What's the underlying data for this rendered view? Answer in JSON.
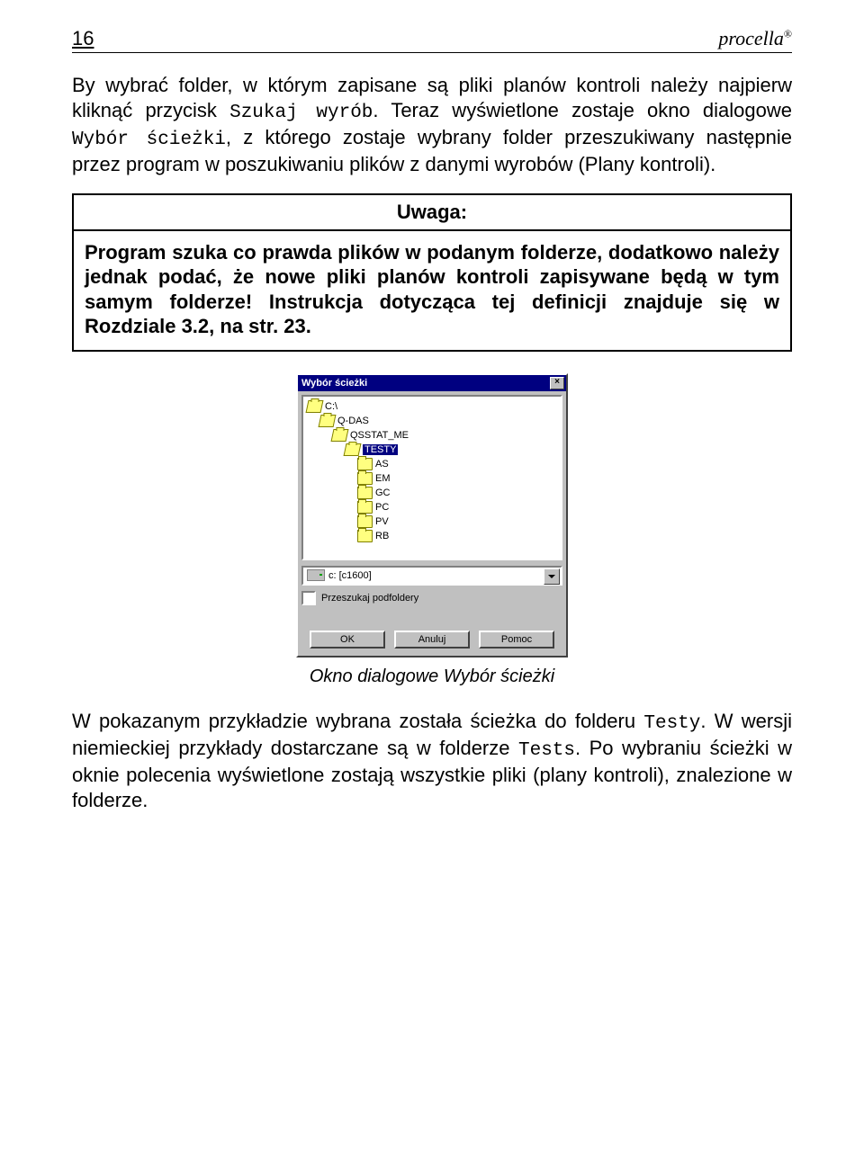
{
  "header": {
    "page_number": "16",
    "brand": "procella",
    "reg_mark": "®"
  },
  "para1": {
    "t1": "By wybrać folder, w którym zapisane są pliki planów kontroli należy najpierw kliknąć przycisk ",
    "mono1": "Szukaj wyrób",
    "t2": ". Teraz wyświetlone zostaje okno dialogowe ",
    "mono2": "Wybór ścieżki",
    "t3": ", z którego zostaje wybrany folder przeszukiwany następnie przez program w poszukiwaniu plików z danymi wyrobów (Plany kontroli)."
  },
  "uwaga": {
    "title": "Uwaga:",
    "body": "Program szuka co prawda plików w podanym folderze, dodatkowo należy jednak podać, że nowe pliki planów kontroli zapisywane będą w tym samym folderze! Instrukcja dotycząca tej definicji znajduje się w Rozdziale 3.2, na str. 23."
  },
  "dialog": {
    "title": "Wybór ścieżki",
    "tree": [
      {
        "indent": 4,
        "open": true,
        "label": "C:\\",
        "selected": false
      },
      {
        "indent": 18,
        "open": true,
        "label": "Q-DAS",
        "selected": false
      },
      {
        "indent": 32,
        "open": true,
        "label": "QSSTAT_ME",
        "selected": false
      },
      {
        "indent": 46,
        "open": true,
        "label": "TESTY",
        "selected": true
      },
      {
        "indent": 60,
        "open": false,
        "label": "AS",
        "selected": false
      },
      {
        "indent": 60,
        "open": false,
        "label": "EM",
        "selected": false
      },
      {
        "indent": 60,
        "open": false,
        "label": "GC",
        "selected": false
      },
      {
        "indent": 60,
        "open": false,
        "label": "PC",
        "selected": false
      },
      {
        "indent": 60,
        "open": false,
        "label": "PV",
        "selected": false
      },
      {
        "indent": 60,
        "open": false,
        "label": "RB",
        "selected": false
      }
    ],
    "drive": "c: [c1600]",
    "checkbox_label": "Przeszukaj podfoldery",
    "buttons": {
      "ok": "OK",
      "cancel": "Anuluj",
      "help": "Pomoc"
    }
  },
  "caption": "Okno dialogowe Wybór ścieżki",
  "para2": {
    "t1": "W pokazanym przykładzie wybrana została ścieżka do folderu ",
    "mono1": "Testy",
    "t2": ". W wersji niemieckiej przykłady dostarczane są w folderze ",
    "mono2": "Tests",
    "t3": ".  Po wybraniu ścieżki w oknie polecenia wyświetlone zostają wszystkie pliki (plany kontroli), znalezione w folderze."
  }
}
